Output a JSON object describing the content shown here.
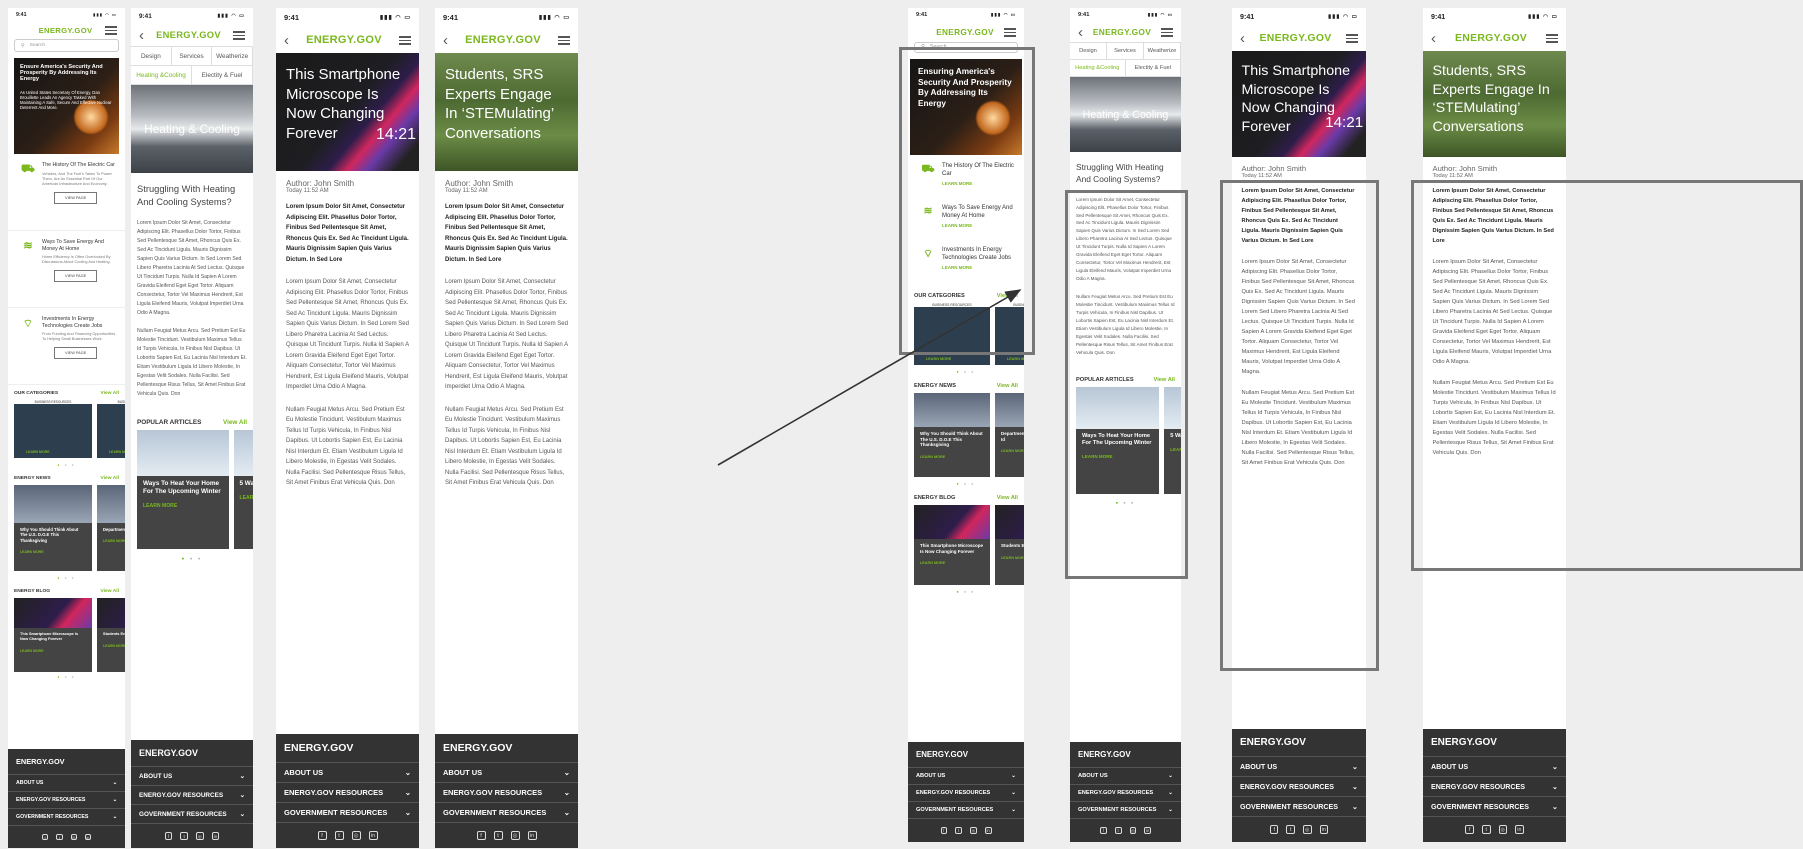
{
  "brand": "ENERGY.GOV",
  "status_time": "9:41",
  "search_placeholder": "Search",
  "home": {
    "hero_title": "Ensure America's Security And Prosperity By Addressing Its Energy",
    "hero_sub": "As United States Secretary Of Energy, Dan Brouillette Leads An Agency Tasked With Maintaining A Safe, Secure And Effective Nuclear Deterrent And More.",
    "features": [
      {
        "icon": "truck-icon",
        "glyph": "⛟",
        "title": "The History Of The Electric Car",
        "desc": "Vehicles, And The Fuel's Takes To Power Them, Are An Essential Part Of Our American Infrastructure And Economy.",
        "button": "VIEW PAGE"
      },
      {
        "icon": "wifi-icon",
        "glyph": "≋",
        "title": "Ways To Save Energy And Money At Home",
        "desc": "Home Efficiency Is Often Overlooked By Discussions About Cooling And Heating.",
        "button": "VIEW PAGE"
      },
      {
        "icon": "signal-icon",
        "glyph": "⌔",
        "title": "Investments In Energy Technologies Create Jobs",
        "desc": "From Funding And Financing Opportunities To Helping Small Businesses Work.",
        "button": "VIEW PAGE"
      }
    ],
    "categories_label": "OUR CATEGORIES",
    "view_all": "View All",
    "category_card_label": "BUSINESS RESOURCES",
    "learn_more": "LEARN MORE",
    "news_label": "ENERGY NEWS",
    "news_cards": [
      "Why You Should Think About The U.S. D.O.E This Thanksgiving",
      "Department Of Energy Flue Id"
    ],
    "blog_label": "ENERGY BLOG",
    "blog_cards": [
      "This Smartphone Microscope Is Now Changing Forever",
      "Students Engage Conversations"
    ]
  },
  "category": {
    "tabs": [
      "Design",
      "Services",
      "Weatherize"
    ],
    "subtabs": [
      "Heating &Cooling",
      "Electity & Fuel"
    ],
    "hero": "Heating & Cooling",
    "heading": "Struggling With Heating And Cooling Systems?",
    "p1": "Lorem Ipsum Dolor Sit Amet, Consectetur Adipiscing Elit. Phasellus Dolor Tortor, Finibus Sed Pellentesque Sit Amet, Rhoncus Quis Ex. Sed Ac Tincidunt Ligula. Mauris Dignissim Sapien Quis Varius Dictum. In Sed Lorem Sed Libero Pharetra Lacinia At Sed Lectus. Quisque Ut Tincidunt Turpis. Nulla Id Sapien A Lorem Gravida Eleifend Eget Eget Tortor. Aliquam Consectetur, Tortor Vel Maximus Hendrerit, Est Ligula Eleifend Mauris, Volutpat Imperdiet Urna Odio A Magna.",
    "p2": "Nullam Feugiat Metus Arcu. Sed Pretium Est Eu Molestie Tincidunt. Vestibulum Maximus Tellus Id Turpis Vehicula, In Finibus Nisl Dapibus. Ut Lobortis Sapien Est, Eu Lacinia Nisl Interdum Et. Etiam Vestibulum Ligula Id Libero Molestie, In Egestas Velit Sodales. Nulla Facilisi. Sed Pellentesque Risus Tellus, Sit Amet Finibus Erat Vehicula Quis. Don",
    "popular_label": "POPULAR ARTICLES",
    "popular_cards": [
      "Ways To Heat Your Home For The Upcoming Winter",
      "5 Ways Money Laundr"
    ]
  },
  "article1": {
    "title": "This Smartphone Microscope Is Now  Changing Forever",
    "phone_time": "14:21"
  },
  "article2": {
    "title": "Students, SRS Experts Engage In ‘STEMulating’ Conversations"
  },
  "article": {
    "author": "Author: John Smith",
    "date": "Today 11:52 AM",
    "lead": "Lorem Ipsum Dolor Sit Amet, Consectetur Adipiscing Elit. Phasellus Dolor Tortor, Finibus Sed Pellentesque Sit Amet, Rhoncus Quis Ex. Sed Ac Tincidunt Ligula. Mauris Dignissim Sapien Quis Varius Dictum. In Sed Lore",
    "p1": "Lorem Ipsum Dolor Sit Amet, Consectetur Adipiscing Elit. Phasellus Dolor Tortor, Finibus Sed Pellentesque Sit Amet, Rhoncus Quis Ex. Sed Ac Tincidunt Ligula. Mauris Dignissim Sapien Quis Varius Dictum. In Sed Lorem Sed Libero Pharetra Lacinia At Sed Lectus. Quisque Ut Tincidunt Turpis. Nulla Id Sapien A Lorem Gravida Eleifend Eget Eget Tortor. Aliquam Consectetur, Tortor Vel Maximus Hendrerit, Est Ligula Eleifend Mauris, Volutpat Imperdiet Urna Odio A Magna.",
    "p2": "Nullam Feugiat Metus Arcu. Sed Pretium Est Eu Molestie Tincidunt. Vestibulum Maximus Tellus Id Turpis Vehicula, In Finibus Nisl Dapibus. Ut Lobortis Sapien Est, Eu Lacinia Nisl Interdum Et. Etiam Vestibulum Ligula Id Libero Molestie, In Egestas Velit Sodales. Nulla Facilisi. Sed Pellentesque Risus Tellus, Sit Amet Finibus Erat Vehicula Quis. Don"
  },
  "footer": {
    "items": [
      "ABOUT US",
      "ENERGY.GOV RESOURCES",
      "GOVERNMENT RESOURCES"
    ],
    "social": [
      "facebook-icon",
      "twitter-icon",
      "instagram-icon",
      "linkedin-icon"
    ]
  },
  "zoom_home": {
    "hero_title": "Ensuring America's Security And Prosperity By Addressing Its Energy",
    "features": [
      "The History Of The Electric Car",
      "Ways To Save Energy And Money At Home",
      "Investments In Energy Technologies Create Jobs"
    ],
    "news_card": "Why You Should Think About The U.S. D.O.E This Thanksgiving",
    "news_card2": "Department Of Energy Fluor Id",
    "blog_card": "This Smartphone Microscope Is Now Changing Forever",
    "blog_card2": "Students Engage Conve"
  },
  "colors": {
    "accent": "#7ab81e",
    "footer": "#333333",
    "highlight": "#777777"
  }
}
